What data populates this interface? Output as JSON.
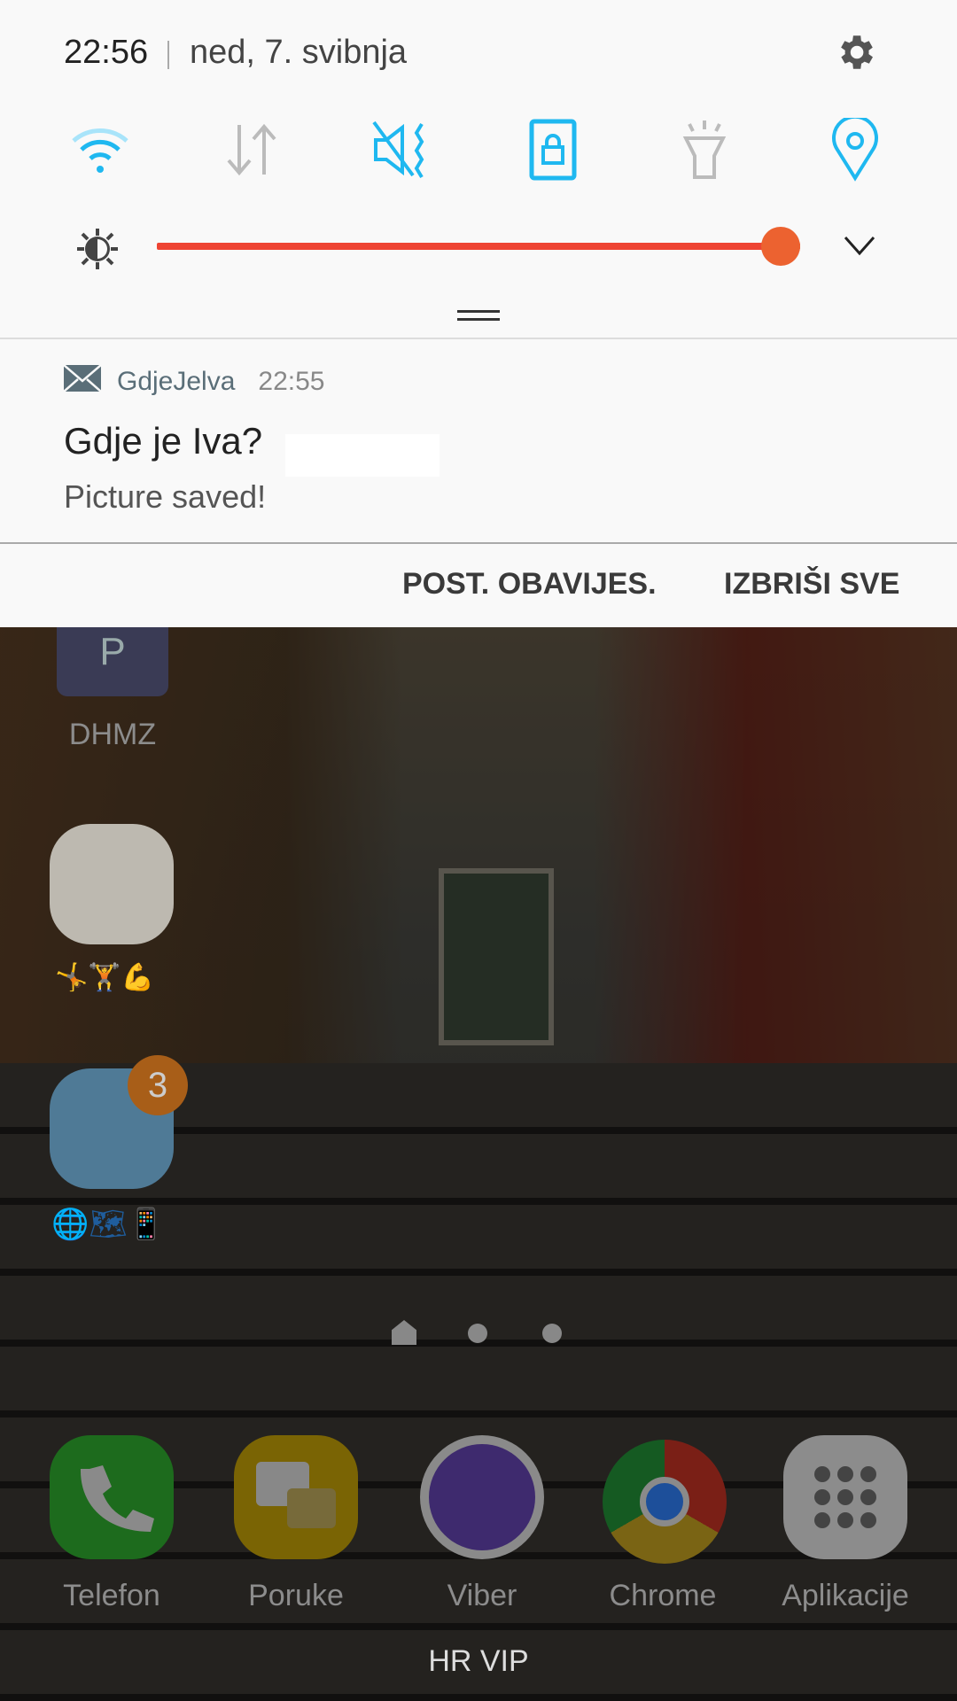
{
  "status": {
    "time": "22:56",
    "date": "ned, 7. svibnja"
  },
  "quick_settings": [
    {
      "icon": "wifi-icon",
      "active": true
    },
    {
      "icon": "mobile-data-icon",
      "active": false
    },
    {
      "icon": "sound-mute-icon",
      "active": true
    },
    {
      "icon": "screen-lock-rotation-icon",
      "active": true
    },
    {
      "icon": "flashlight-icon",
      "active": false
    },
    {
      "icon": "location-icon",
      "active": true
    }
  ],
  "brightness": {
    "level_percent": 100
  },
  "notification": {
    "app": "GdjeJelva",
    "time": "22:55",
    "title": "Gdje je Iva?",
    "body": "Picture saved!"
  },
  "actions": {
    "settings": "POST. OBAVIJES.",
    "clear_all": "IZBRIŠI SVE"
  },
  "home": {
    "dhmz_letter": "P",
    "dhmz_label": "DHMZ",
    "folder_badge": "3",
    "dock": [
      "Telefon",
      "Poruke",
      "Viber",
      "Chrome",
      "Aplikacije"
    ],
    "carrier": "HR VIP"
  },
  "colors": {
    "accent": "#1fb8f0",
    "slider": "#ee4433",
    "knob": "#ec6230"
  }
}
